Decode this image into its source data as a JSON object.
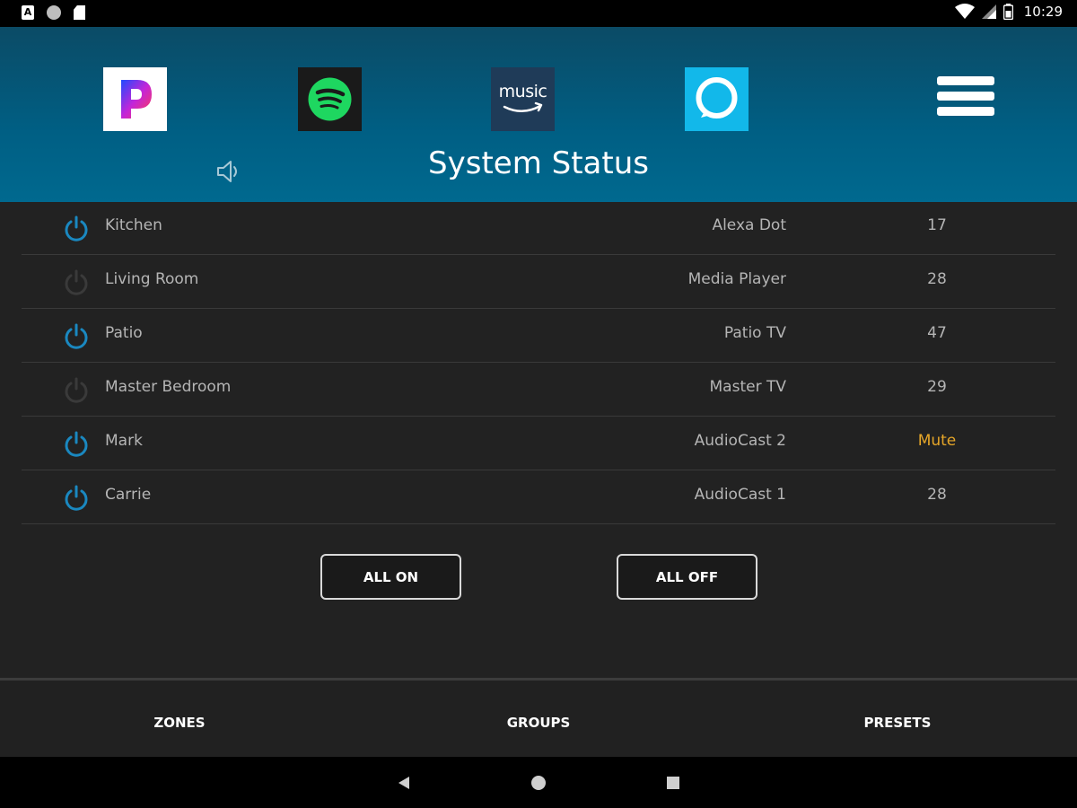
{
  "status_bar": {
    "left_icons": [
      "a-badge-icon",
      "circle-icon",
      "sd-card-icon"
    ],
    "right_icons": [
      "wifi-icon",
      "signal-icon",
      "battery-icon"
    ],
    "a_badge": "A",
    "time": "10:29"
  },
  "header": {
    "apps": [
      {
        "name": "Pandora",
        "icon": "pandora-icon"
      },
      {
        "name": "Spotify",
        "icon": "spotify-icon"
      },
      {
        "name": "Amazon Music",
        "icon": "amazon-music-icon",
        "text": "music"
      },
      {
        "name": "Alexa",
        "icon": "alexa-icon"
      }
    ],
    "menu_icon": "hamburger-menu-icon",
    "speaker_icon": "speaker-icon",
    "title": "System Status"
  },
  "zones": [
    {
      "name": "Kitchen",
      "source": "Alexa Dot",
      "volume": "17",
      "power": "on"
    },
    {
      "name": "Living Room",
      "source": "Media Player",
      "volume": "28",
      "power": "off"
    },
    {
      "name": "Patio",
      "source": "Patio TV",
      "volume": "47",
      "power": "on"
    },
    {
      "name": "Master Bedroom",
      "source": "Master TV",
      "volume": "29",
      "power": "off"
    },
    {
      "name": "Mark",
      "source": "AudioCast 2",
      "volume": "Mute",
      "power": "on"
    },
    {
      "name": "Carrie",
      "source": "AudioCast 1",
      "volume": "28",
      "power": "on"
    }
  ],
  "actions": {
    "all_on": "ALL ON",
    "all_off": "ALL OFF"
  },
  "bottom_nav": {
    "zones": "ZONES",
    "groups": "GROUPS",
    "presets": "PRESETS"
  },
  "system_nav": [
    "back-icon",
    "home-icon",
    "recents-icon"
  ],
  "colors": {
    "header_blue": "#005f84",
    "power_on": "#1a88c0",
    "power_off": "#3a3a3a",
    "mute_text": "#e6a628",
    "background": "#222222"
  }
}
